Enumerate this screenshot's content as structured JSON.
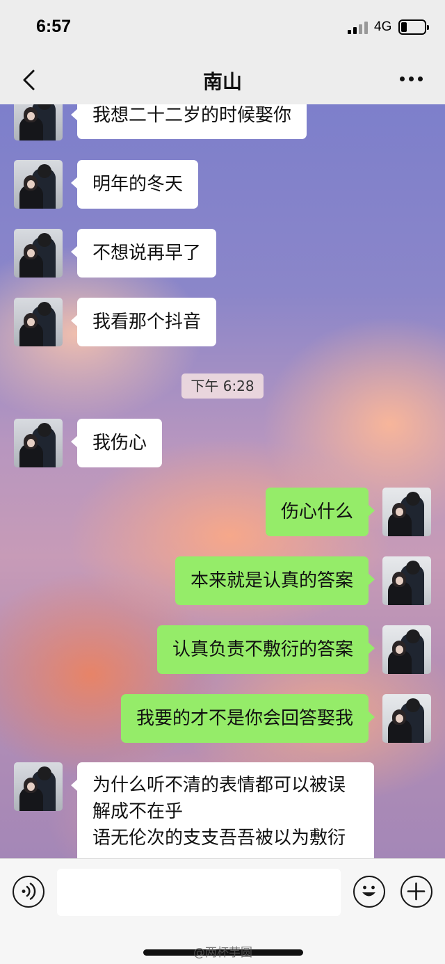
{
  "status_bar": {
    "time": "6:57",
    "network": "4G"
  },
  "nav": {
    "title": "南山"
  },
  "messages": [
    {
      "side": "left",
      "text": "我想二十二岁的时候娶你"
    },
    {
      "side": "left",
      "text": "明年的冬天"
    },
    {
      "side": "left",
      "text": "不想说再早了"
    },
    {
      "side": "left",
      "text": "我看那个抖音"
    },
    {
      "side": "left",
      "text": "我伤心"
    },
    {
      "side": "right",
      "text": "伤心什么"
    },
    {
      "side": "right",
      "text": "本来就是认真的答案"
    },
    {
      "side": "right",
      "text": "认真负责不敷衍的答案"
    },
    {
      "side": "right",
      "text": "我要的才不是你会回答娶我"
    },
    {
      "side": "left",
      "text": "为什么听不清的表情都可以被误解成不在乎\n语无伦次的支支吾吾被以为敷衍"
    }
  ],
  "timestamp": "下午 6:28",
  "input_bar": {
    "input_value": ""
  },
  "watermark": "@两杯芋圆",
  "colors": {
    "sent_bubble": "#95ec69",
    "received_bubble": "#ffffff",
    "bar_background": "#ededed"
  }
}
